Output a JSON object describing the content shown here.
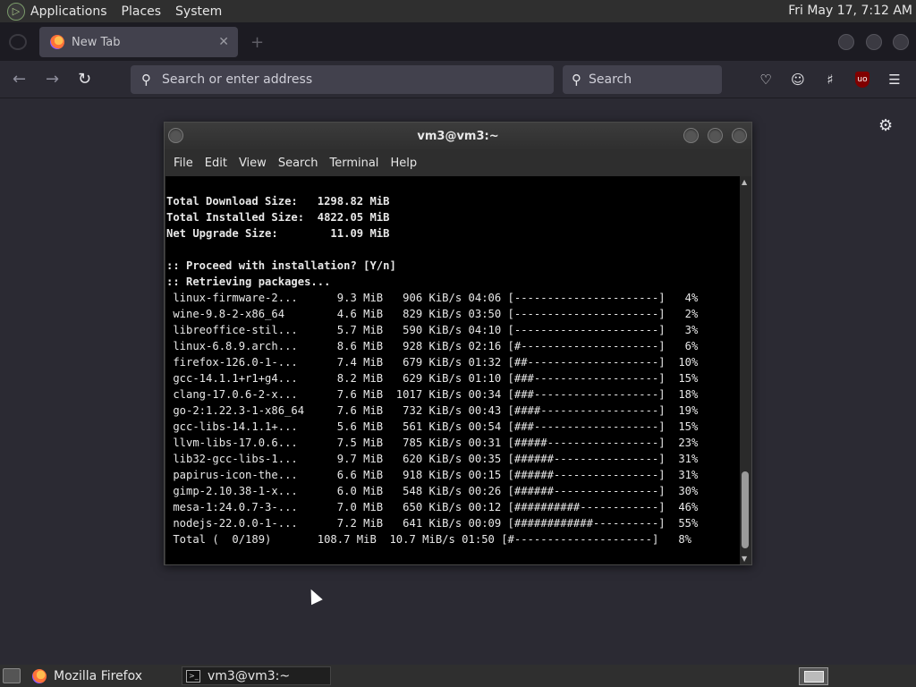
{
  "top_panel": {
    "menus": [
      "Applications",
      "Places",
      "System"
    ],
    "clock": "Fri May 17,  7:12 AM"
  },
  "firefox": {
    "tab_title": "New Tab",
    "url_placeholder": "Search or enter address",
    "search_placeholder": "Search",
    "ublock_label": "uo"
  },
  "terminal": {
    "title": "vm3@vm3:~",
    "menus": [
      "File",
      "Edit",
      "View",
      "Search",
      "Terminal",
      "Help"
    ],
    "summary": [
      "Total Download Size:   1298.82 MiB",
      "Total Installed Size:  4822.05 MiB",
      "Net Upgrade Size:        11.09 MiB"
    ],
    "prompt_lines": [
      ":: Proceed with installation? [Y/n]",
      ":: Retrieving packages..."
    ],
    "downloads": [
      " linux-firmware-2...      9.3 MiB   906 KiB/s 04:06 [----------------------]   4%",
      " wine-9.8-2-x86_64        4.6 MiB   829 KiB/s 03:50 [----------------------]   2%",
      " libreoffice-stil...      5.7 MiB   590 KiB/s 04:10 [----------------------]   3%",
      " linux-6.8.9.arch...      8.6 MiB   928 KiB/s 02:16 [#---------------------]   6%",
      " firefox-126.0-1-...      7.4 MiB   679 KiB/s 01:32 [##--------------------]  10%",
      " gcc-14.1.1+r1+g4...      8.2 MiB   629 KiB/s 01:10 [###-------------------]  15%",
      " clang-17.0.6-2-x...      7.6 MiB  1017 KiB/s 00:34 [###-------------------]  18%",
      " go-2:1.22.3-1-x86_64     7.6 MiB   732 KiB/s 00:43 [####------------------]  19%",
      " gcc-libs-14.1.1+...      5.6 MiB   561 KiB/s 00:54 [###-------------------]  15%",
      " llvm-libs-17.0.6...      7.5 MiB   785 KiB/s 00:31 [#####-----------------]  23%",
      " lib32-gcc-libs-1...      9.7 MiB   620 KiB/s 00:35 [######----------------]  31%",
      " papirus-icon-the...      6.6 MiB   918 KiB/s 00:15 [######----------------]  31%",
      " gimp-2.10.38-1-x...      6.0 MiB   548 KiB/s 00:26 [######----------------]  30%",
      " mesa-1:24.0.7-3-...      7.0 MiB   650 KiB/s 00:12 [##########------------]  46%",
      " nodejs-22.0.0-1-...      7.2 MiB   641 KiB/s 00:09 [############----------]  55%",
      " Total (  0/189)       108.7 MiB  10.7 MiB/s 01:50 [#---------------------]   8%"
    ]
  },
  "taskbar": {
    "tasks": [
      "Mozilla Firefox",
      "vm3@vm3:~"
    ]
  },
  "colors": {
    "firefox_bg": "#2b2a33",
    "panel_bg": "#2f2f2f",
    "terminal_bg": "#000000",
    "terminal_fg": "#e8e8e8"
  }
}
